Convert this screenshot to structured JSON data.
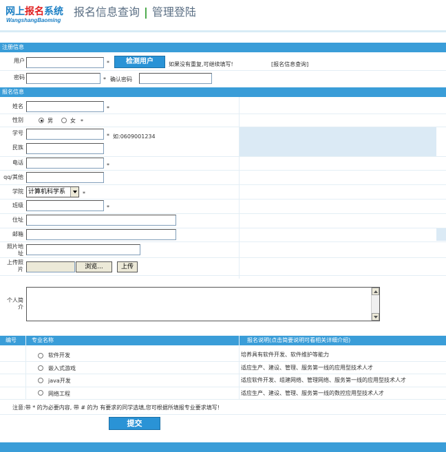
{
  "header": {
    "logo_cn_a": "网上",
    "logo_cn_b": "报名",
    "logo_cn_c": "系统",
    "logo_en": "WangshangBaoming",
    "nav_query": "报名信息查询",
    "nav_sep": "|",
    "nav_admin": "管理登陆"
  },
  "register": {
    "section_title": "注册信息",
    "user_label": "用户",
    "check_button": "检测用户",
    "dup_hint": "如果没有重复,可继续填写!",
    "query_link": "[报名信息查询]",
    "password_label": "密码",
    "confirm_label": "确认密码",
    "star": "*"
  },
  "signup": {
    "section_title": "报名信息",
    "name_label": "姓名",
    "gender_label": "性别",
    "gender_male": "男",
    "gender_female": "女",
    "student_id_label": "学号",
    "student_id_hint": "如:0609001234",
    "ethnicity_label": "民族",
    "phone_label": "电话",
    "qq_label": "qq/其他",
    "college_label": "学院",
    "college_value": "计算机科学系",
    "class_label": "班级",
    "address_label": "住址",
    "email_label": "邮箱",
    "photo_addr_label_1": "照片地",
    "photo_addr_label_2": "址",
    "upload_label_1": "上传照",
    "upload_label_2": "片",
    "browse_button": "浏览...",
    "upload_button": "上传",
    "intro_label_1": "个人简",
    "intro_label_2": "介"
  },
  "majors": {
    "col_id": "编号",
    "col_name": "专业名称",
    "col_desc": "报名说明(点击简要说明可看相关详细介绍)",
    "rows": [
      {
        "name": "软件开发",
        "desc": "培养具有软件开发、软件维护等能力"
      },
      {
        "name": "嵌入式游戏",
        "desc": "适应生产、建设、管理、服务第一线的应用型技术人才"
      },
      {
        "name": "java开发",
        "desc": "适应软件开发、组建网络、管理网络、服务第一线的应用型技术人才"
      },
      {
        "name": "网络工程",
        "desc": "适应生产、建设、管理、服务第一线的数控应用型技术人才"
      }
    ]
  },
  "note": "注意:带 * 的为必要内容, 带 # 的为 有要求的同学选填,您可根据所填报专业要求填写!",
  "submit_button": "提交",
  "colors": {
    "accent": "#3a9dd8",
    "brand": "#1b7fc4",
    "logo_red": "#e02020",
    "nav_sep": "#3aa23a",
    "shade": "#dbeaf5"
  }
}
